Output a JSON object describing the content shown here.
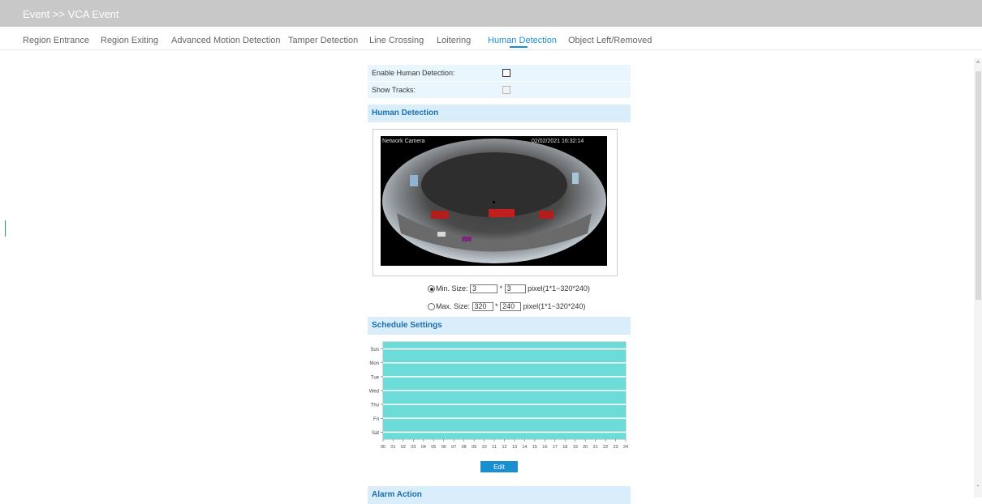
{
  "header": {
    "title": "Event >> VCA Event"
  },
  "tabs": [
    {
      "label": "Region Entrance"
    },
    {
      "label": "Region Exiting"
    },
    {
      "label": "Advanced Motion Detection"
    },
    {
      "label": "Tamper Detection"
    },
    {
      "label": "Line Crossing"
    },
    {
      "label": "Loitering"
    },
    {
      "label": "Human Detection",
      "active": true
    },
    {
      "label": "Object Left/Removed"
    }
  ],
  "form": {
    "enable_label": "Enable Human Detection:",
    "enable_checked": false,
    "show_tracks_label": "Show Tracks:",
    "show_tracks_checked": false
  },
  "human_detection": {
    "section_title": "Human Detection",
    "video": {
      "overlay_name": "Network Camera",
      "overlay_time": "02/02/2021 16:32:14"
    },
    "min_size": {
      "label": "Min. Size:",
      "w": "3",
      "sep": "*",
      "h": "3",
      "hint": "pixel(1*1~320*240)",
      "selected": true
    },
    "max_size": {
      "label": "Max. Size:",
      "w": "320",
      "sep": "*",
      "h": "240",
      "hint": "pixel(1*1~320*240)",
      "selected": false
    }
  },
  "schedule": {
    "section_title": "Schedule Settings",
    "days": [
      "Sun",
      "Mon",
      "Tue",
      "Wed",
      "Thu",
      "Fri",
      "Sat"
    ],
    "hours": [
      "00",
      "01",
      "02",
      "03",
      "04",
      "05",
      "06",
      "07",
      "08",
      "09",
      "10",
      "11",
      "12",
      "13",
      "14",
      "15",
      "16",
      "17",
      "18",
      "19",
      "20",
      "21",
      "22",
      "23",
      "24"
    ],
    "fill_color": "#6ddcd8",
    "line_color": "#ffffff",
    "coverage": "all days, 00-24",
    "edit_label": "Edit"
  },
  "alarm": {
    "section_title": "Alarm Action"
  },
  "colors": {
    "accent": "#1a8fd0",
    "section_bg": "#d9eefa",
    "row_bg": "#eaf6fd",
    "titlebar": "#c8c8c8"
  }
}
